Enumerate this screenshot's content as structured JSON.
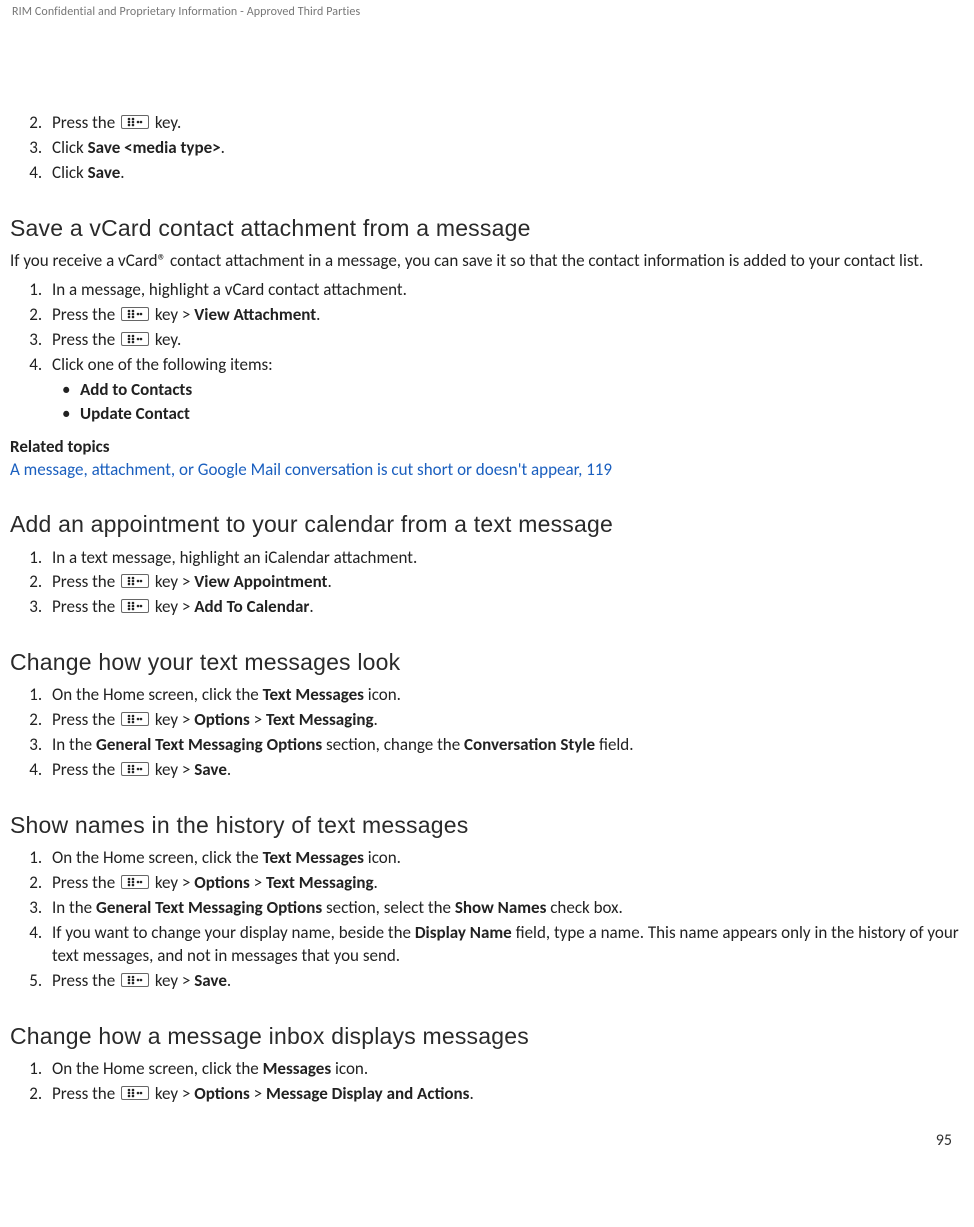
{
  "header": "RIM Confidential and Proprietary Information - Approved Third Parties",
  "intro_list": {
    "step2a": "Press the ",
    "step2b": " key.",
    "step3a": "Click ",
    "step3b": "Save <media type>",
    "step3c": ".",
    "step4a": "Click ",
    "step4b": "Save",
    "step4c": "."
  },
  "s1": {
    "title": "Save a vCard contact attachment from a message",
    "desc": "If you receive a vCard® contact attachment in a message, you can save it so that the contact information is added to your contact list.",
    "step1": "In a message, highlight a vCard contact attachment.",
    "step2a": "Press the ",
    "step2b": " key > ",
    "step2c": "View Attachment",
    "step2d": ".",
    "step3a": "Press the ",
    "step3b": " key.",
    "step4": "Click one of the following items:",
    "opt1": "Add to Contacts",
    "opt2": "Update Contact",
    "related_head": "Related topics",
    "related_link": "A message, attachment, or Google Mail conversation is cut short or doesn't appear, 119"
  },
  "s2": {
    "title": "Add an appointment to your calendar from a text message",
    "step1": "In a text message, highlight an iCalendar attachment.",
    "step2a": "Press the ",
    "step2b": " key > ",
    "step2c": "View Appointment",
    "step2d": ".",
    "step3a": "Press the ",
    "step3b": " key > ",
    "step3c": "Add To Calendar",
    "step3d": "."
  },
  "s3": {
    "title": "Change how your text messages look",
    "step1a": "On the Home screen, click the ",
    "step1b": "Text Messages",
    "step1c": " icon.",
    "step2a": "Press the ",
    "step2b": " key > ",
    "step2c": "Options",
    "step2d": " > ",
    "step2e": "Text Messaging",
    "step2f": ".",
    "step3a": "In the ",
    "step3b": "General Text Messaging Options",
    "step3c": " section, change the ",
    "step3d": "Conversation Style",
    "step3e": " field.",
    "step4a": "Press the ",
    "step4b": " key > ",
    "step4c": "Save",
    "step4d": "."
  },
  "s4": {
    "title": "Show names in the history of text messages",
    "step1a": "On the Home screen, click the ",
    "step1b": "Text Messages",
    "step1c": " icon.",
    "step2a": "Press the ",
    "step2b": " key > ",
    "step2c": "Options",
    "step2d": " > ",
    "step2e": "Text Messaging",
    "step2f": ".",
    "step3a": "In the ",
    "step3b": "General Text Messaging Options",
    "step3c": " section, select the ",
    "step3d": "Show Names",
    "step3e": " check box.",
    "step4a": "If you want to change your display name, beside the ",
    "step4b": "Display Name",
    "step4c": " field, type a name. This name appears only in the history of your text messages, and not in messages that you send.",
    "step5a": "Press the ",
    "step5b": " key > ",
    "step5c": "Save",
    "step5d": "."
  },
  "s5": {
    "title": "Change how a message inbox displays messages",
    "step1a": "On the Home screen, click the ",
    "step1b": "Messages",
    "step1c": " icon.",
    "step2a": "Press the ",
    "step2b": " key > ",
    "step2c": "Options",
    "step2d": " > ",
    "step2e": "Message Display and Actions",
    "step2f": "."
  },
  "page_number": "95"
}
